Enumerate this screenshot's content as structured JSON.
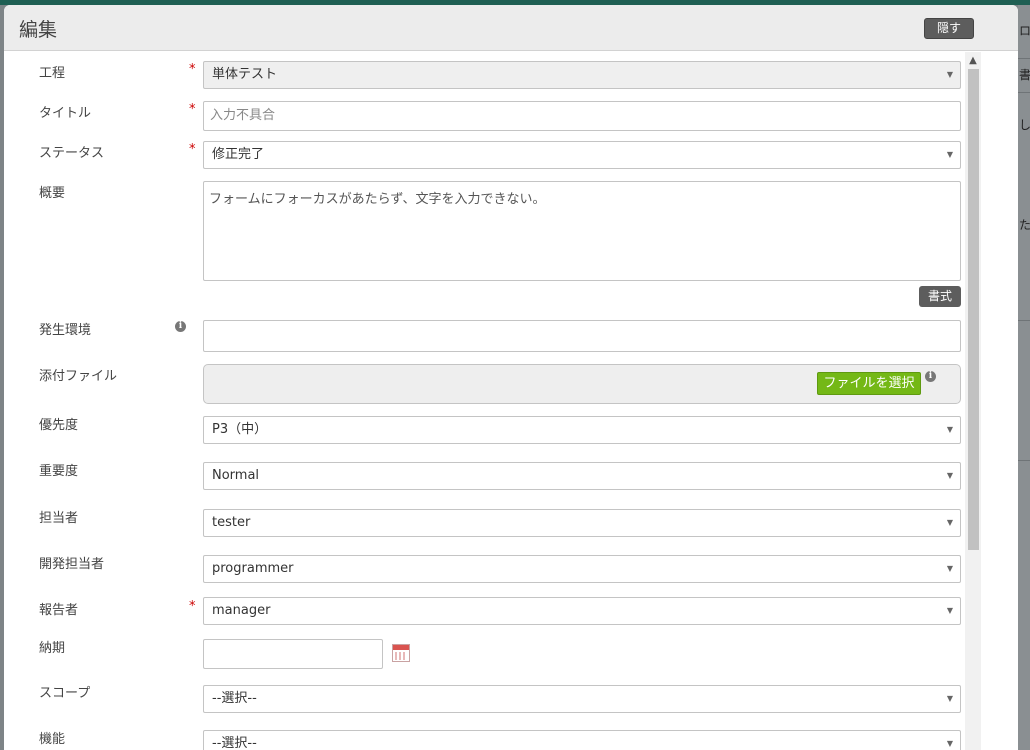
{
  "background": {
    "fragments": [
      "ロ",
      "書",
      "し",
      "た"
    ]
  },
  "dialog": {
    "title": "編集",
    "hide_label": "隠す"
  },
  "form": {
    "process": {
      "label": "工程",
      "required": "*",
      "value": "単体テスト"
    },
    "title_field": {
      "label": "タイトル",
      "required": "*",
      "value": "入力不具合"
    },
    "status": {
      "label": "ステータス",
      "required": "*",
      "value": "修正完了"
    },
    "summary": {
      "label": "概要",
      "value": "フォームにフォーカスがあたらず、文字を入力できない。",
      "format_label": "書式"
    },
    "environment": {
      "label": "発生環境",
      "info": "i",
      "value": ""
    },
    "attachment": {
      "label": "添付ファイル",
      "button_label": "ファイルを選択",
      "info": "i"
    },
    "priority": {
      "label": "優先度",
      "value": "P3（中）"
    },
    "severity": {
      "label": "重要度",
      "value": "Normal"
    },
    "assignee": {
      "label": "担当者",
      "value": "tester"
    },
    "developer": {
      "label": "開発担当者",
      "value": "programmer"
    },
    "reporter": {
      "label": "報告者",
      "required": "*",
      "value": "manager"
    },
    "due_date": {
      "label": "納期",
      "value": ""
    },
    "scope": {
      "label": "スコープ",
      "value": "--選択--"
    },
    "feature": {
      "label": "機能",
      "value": "--選択--"
    }
  },
  "icons": {
    "caret": "▼",
    "scroll_up": "▲"
  }
}
